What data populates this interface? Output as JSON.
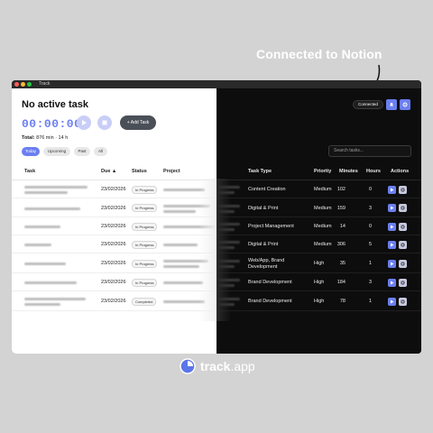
{
  "callout": "Connected to Notion",
  "window": {
    "title": "Track"
  },
  "left": {
    "heading": "No active task",
    "timer": "00:00:00",
    "add_task": "Add Task",
    "total_label": "Total:",
    "total_value": "876 min · 14 h",
    "filters": [
      "Today",
      "Upcoming",
      "Past",
      "All"
    ]
  },
  "right": {
    "connected": "Connected",
    "search_placeholder": "Search tasks..."
  },
  "table": {
    "headers": {
      "task": "Task",
      "due": "Due ▲",
      "status": "Status",
      "project": "Project",
      "task_type": "Task Type",
      "priority": "Priority",
      "minutes": "Minutes",
      "hours": "Hours",
      "actions": "Actions"
    },
    "rows": [
      {
        "due": "23/02/2026",
        "status": "In Progress",
        "task_type": "Content Creation",
        "priority": "Medium",
        "minutes": "102",
        "hours": "0"
      },
      {
        "due": "23/02/2026",
        "status": "In Progress",
        "task_type": "Digital & Print",
        "priority": "Medium",
        "minutes": "159",
        "hours": "3"
      },
      {
        "due": "23/02/2026",
        "status": "In Progress",
        "task_type": "Project Management",
        "priority": "Medium",
        "minutes": "14",
        "hours": "0"
      },
      {
        "due": "23/02/2026",
        "status": "In Progress",
        "task_type": "Digital & Print",
        "priority": "Medium",
        "minutes": "306",
        "hours": "5"
      },
      {
        "due": "23/02/2026",
        "status": "In Progress",
        "task_type": "Web/App, Brand Development",
        "priority": "High",
        "minutes": "35",
        "hours": "1"
      },
      {
        "due": "23/02/2026",
        "status": "In Progress",
        "task_type": "Brand Development",
        "priority": "High",
        "minutes": "184",
        "hours": "3"
      },
      {
        "due": "23/02/2026",
        "status": "Completed",
        "task_type": "Brand Development",
        "priority": "High",
        "minutes": "78",
        "hours": "1"
      }
    ]
  },
  "brand": {
    "name": "track",
    "suffix": ".app"
  },
  "colors": {
    "accent": "#6b7ff0",
    "dark_bg": "#0d0d0d",
    "page_bg": "#d3d3d3"
  }
}
